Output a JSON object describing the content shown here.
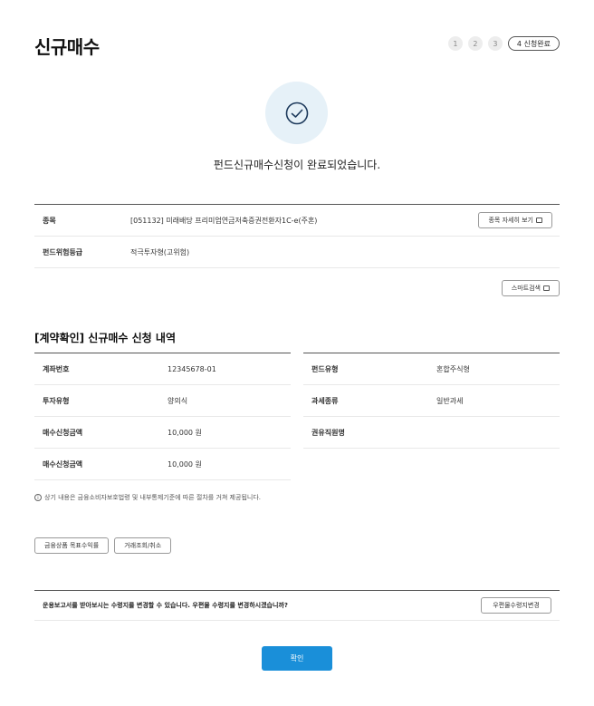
{
  "header": {
    "title": "신규매수"
  },
  "steps": {
    "items": [
      "1",
      "2",
      "3"
    ],
    "current_label": "4 신청완료"
  },
  "completion": {
    "message": "펀드신규매수신청이 완료되었습니다.",
    "icon": "check-circle-icon"
  },
  "fund_info": {
    "rows": [
      {
        "label": "종목",
        "value": "[051132] 미래배당 프리미엄연금저축증권전환자1C-e(주혼)",
        "button": "종목 자세히 보기"
      },
      {
        "label": "펀드위험등급",
        "value": "적극투자형(고위험)"
      }
    ],
    "smart_search_label": "스마트검색"
  },
  "contract": {
    "title": "[계약확인] 신규매수 신청 내역",
    "left": [
      {
        "label": "계좌번호",
        "value": "12345678-01"
      },
      {
        "label": "투자유형",
        "value": "양의식"
      },
      {
        "label": "매수신청금액",
        "value": "10,000 원"
      },
      {
        "label": "매수신청금액",
        "value": "10,000 원"
      }
    ],
    "right": [
      {
        "label": "펀드유형",
        "value": "혼합주식형"
      },
      {
        "label": "과세종류",
        "value": "일반과세"
      },
      {
        "label": "권유직원명",
        "value": ""
      }
    ]
  },
  "notice": "상기 내용은 금융소비자보호법령 및 내부통제기준에 따른 절차를 거쳐 제공됩니다.",
  "actions": {
    "target_return": "금융상품 목표수익률",
    "trade_query": "거래조회/취소"
  },
  "mail": {
    "message": "운용보고서를 받아보시는 수령지를 변경할 수 있습니다. 우편물 수령지를 변경하시겠습니까?",
    "button": "우편물수령지변경"
  },
  "confirm_label": "확인",
  "colors": {
    "accent": "#1a8fd9",
    "circle_bg": "#e6f1f8"
  }
}
